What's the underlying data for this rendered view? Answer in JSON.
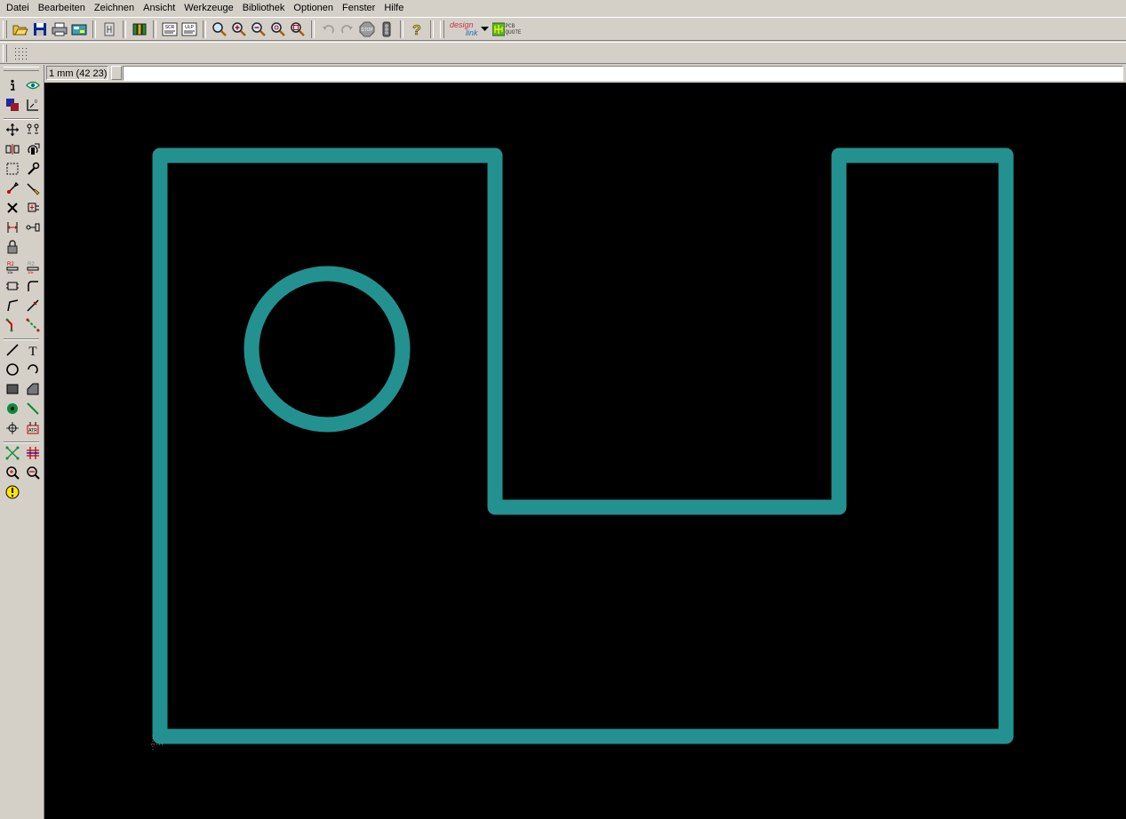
{
  "menu": {
    "items": [
      "Datei",
      "Bearbeiten",
      "Zeichnen",
      "Ansicht",
      "Werkzeuge",
      "Bibliothek",
      "Optionen",
      "Fenster",
      "Hilfe"
    ]
  },
  "toolbar": {
    "buttons": [
      "open-icon",
      "save-icon",
      "print-icon",
      "cam-processor-icon",
      "board-schematic-switch-icon",
      "library-icon",
      "script-icon",
      "ulp-icon",
      "zoom-fit-icon",
      "zoom-in-icon",
      "zoom-out-icon",
      "zoom-redraw-icon",
      "zoom-select-icon",
      "undo-icon",
      "redo-icon",
      "stop-icon",
      "go-icon",
      "help-icon"
    ],
    "designlink": {
      "design": "design",
      "link": "link"
    },
    "pcb_quote": {
      "line1": "PCB",
      "line2": "QUOTE"
    }
  },
  "coordinates": {
    "display": "1 mm (42 23)",
    "command_value": ""
  },
  "colors": {
    "wire": "#239190",
    "canvas_background": "#000000",
    "window_face": "#d4d0c8"
  }
}
